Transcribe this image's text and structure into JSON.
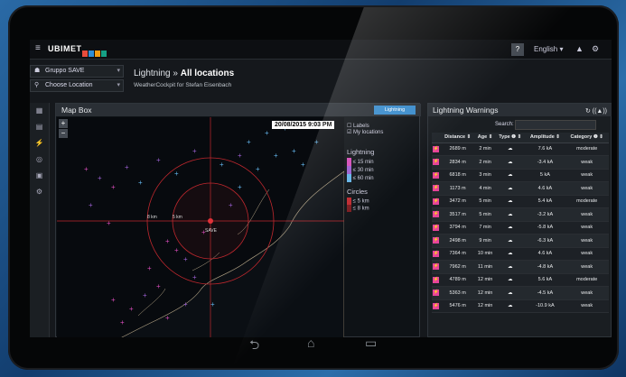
{
  "topbar": {
    "menu_glyph": "≡",
    "logo": "UBIMET",
    "help": "?",
    "language": "English ▾",
    "alert_glyph": "▲",
    "settings_glyph": "⚙",
    "logo_colors": [
      "#e74c3c",
      "#2f8fd7",
      "#f39c12",
      "#16a085",
      "#ffffff"
    ]
  },
  "selectors": {
    "group": "Gruppo SAVE",
    "location": "Choose Location"
  },
  "page": {
    "title_prefix": "Lightning »",
    "title_bold": "All locations",
    "subtitle": "WeatherCockpit for Stefan Eisenbach"
  },
  "sidebar": {
    "icons": [
      "▦",
      "▤",
      "⚡",
      "◎",
      "▣",
      "⚙"
    ]
  },
  "mapbox": {
    "title": "Map Box",
    "lightning_button": "Lightning",
    "timestamp": "20/08/2015 9:03 PM",
    "zoom_in": "+",
    "zoom_out": "−",
    "label_km1": "5 km",
    "label_km2": "8 km",
    "site_label": "SAVE",
    "legend": {
      "labels_checkbox": "Labels",
      "mylocations_checkbox": "My locations",
      "lightning_title": "Lightning",
      "lightning_items": [
        "≤ 15 min",
        "≤ 30 min",
        "≤ 60 min"
      ],
      "circles_title": "Circles",
      "circle_items": [
        "≤ 5 km",
        "≤ 8 km"
      ]
    }
  },
  "warnings": {
    "title": "Lightning Warnings",
    "head_icons": "↻ ((▲))",
    "search_label": "Search:",
    "columns": [
      "Distance ⇕",
      "Age ⇕",
      "Type ❶ ⇕",
      "Amplitude ⇕",
      "Category ❶ ⇕"
    ],
    "rows": [
      {
        "distance": "2689 m",
        "age": "2 min",
        "amplitude": "7.6 kA",
        "category": "moderate"
      },
      {
        "distance": "2834 m",
        "age": "2 min",
        "amplitude": "-3.4 kA",
        "category": "weak"
      },
      {
        "distance": "6818 m",
        "age": "3 min",
        "amplitude": "5 kA",
        "category": "weak"
      },
      {
        "distance": "1173 m",
        "age": "4 min",
        "amplitude": "4.6 kA",
        "category": "weak"
      },
      {
        "distance": "3472 m",
        "age": "5 min",
        "amplitude": "5.4 kA",
        "category": "moderate"
      },
      {
        "distance": "3517 m",
        "age": "5 min",
        "amplitude": "-3.2 kA",
        "category": "weak"
      },
      {
        "distance": "3794 m",
        "age": "7 min",
        "amplitude": "-5.8 kA",
        "category": "weak"
      },
      {
        "distance": "2498 m",
        "age": "9 min",
        "amplitude": "-6.3 kA",
        "category": "weak"
      },
      {
        "distance": "7364 m",
        "age": "10 min",
        "amplitude": "4.6 kA",
        "category": "weak"
      },
      {
        "distance": "7962 m",
        "age": "11 min",
        "amplitude": "-4.8 kA",
        "category": "weak"
      },
      {
        "distance": "4789 m",
        "age": "12 min",
        "amplitude": "5.6 kA",
        "category": "moderate"
      },
      {
        "distance": "5363 m",
        "age": "12 min",
        "amplitude": "-4.5 kA",
        "category": "weak"
      },
      {
        "distance": "5476 m",
        "age": "12 min",
        "amplitude": "-10.9 kA",
        "category": "weak"
      }
    ]
  },
  "navbar": {
    "back": "⮌",
    "home": "⌂",
    "recent": "▭"
  },
  "colors": {
    "accent": "#3a8ccc",
    "strike_recent": "#d54bb8",
    "strike_mid": "#9a5fd0",
    "strike_old": "#62b3e8",
    "circle": "#c0282e"
  }
}
